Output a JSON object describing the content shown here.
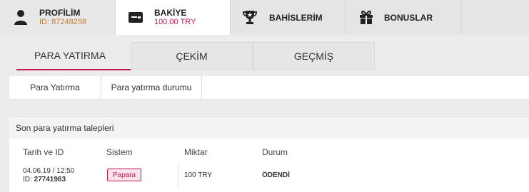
{
  "top_tabs": [
    {
      "icon": "user-icon",
      "title": "PROFİLİM",
      "sub": "ID: 87248258"
    },
    {
      "icon": "wallet-icon",
      "title": "BAKİYE",
      "sub": "100.00 TRY"
    },
    {
      "icon": "trophy-icon",
      "title": "BAHİSLERİM"
    },
    {
      "icon": "gift-icon",
      "title": "BONUSLAR"
    }
  ],
  "sub_tabs": [
    "PARA YATIRMA",
    "ÇEKİM",
    "GEÇMİŞ"
  ],
  "inner_tabs": [
    "Para Yatırma",
    "Para yatırma durumu"
  ],
  "recent": {
    "title": "Son para yatırma talepleri",
    "columns": [
      "Tarih ve ID",
      "Sistem",
      "Miktar",
      "Durum"
    ],
    "rows": [
      {
        "date": "04.06.19 / 12:50",
        "id_label": "ID:",
        "id": "27741963",
        "system": "Papara",
        "amount": "100 TRY",
        "status": "ÖDENDİ"
      }
    ]
  },
  "colors": {
    "accent": "#c2185b",
    "id_orange": "#d07a2a"
  }
}
